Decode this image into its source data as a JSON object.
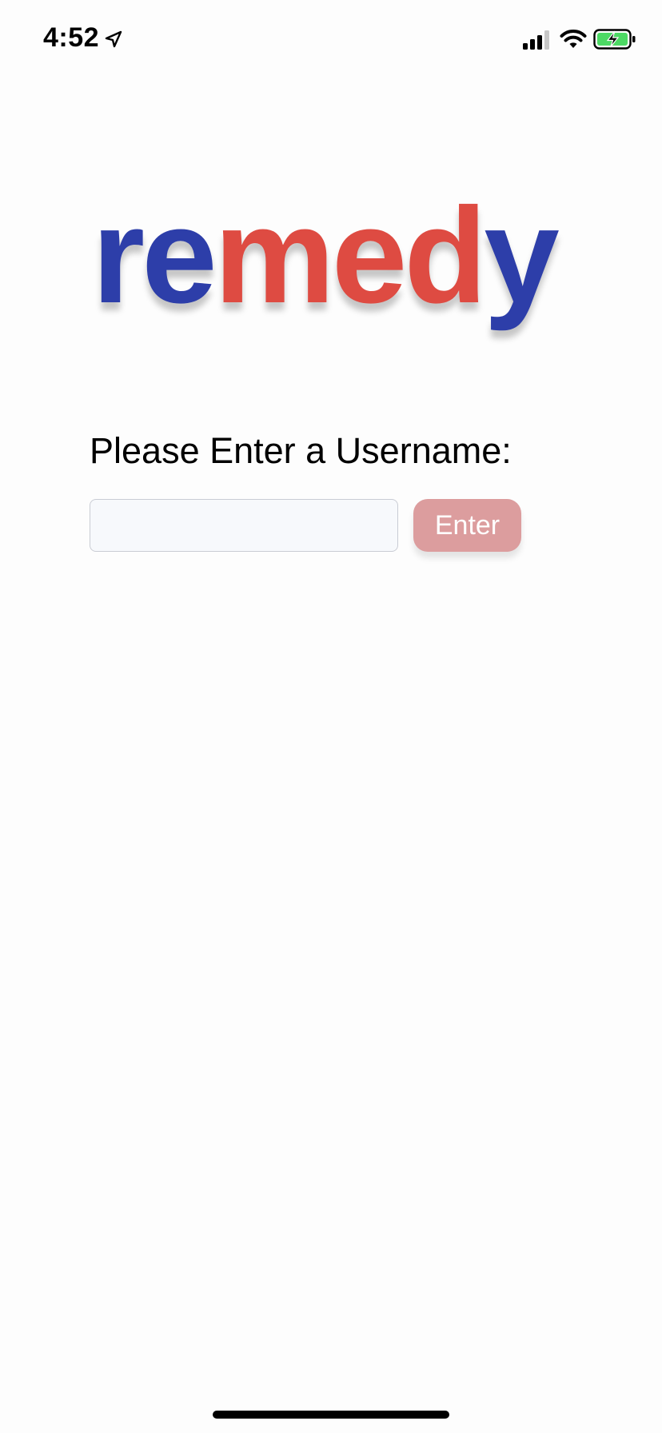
{
  "status_bar": {
    "time": "4:52",
    "icons": [
      "location-arrow-icon",
      "cellular-signal-icon",
      "wifi-icon",
      "battery-charging-icon"
    ],
    "battery_color": "#4cd964"
  },
  "logo": {
    "part1": "re",
    "part2": "med",
    "part3": "y",
    "blue": "#2d3ea9",
    "red": "#de4b42"
  },
  "prompt": {
    "label": "Please Enter a Username:"
  },
  "username_input": {
    "value": "",
    "placeholder": ""
  },
  "enter_button": {
    "label": "Enter",
    "color": "#dc9d9e"
  }
}
